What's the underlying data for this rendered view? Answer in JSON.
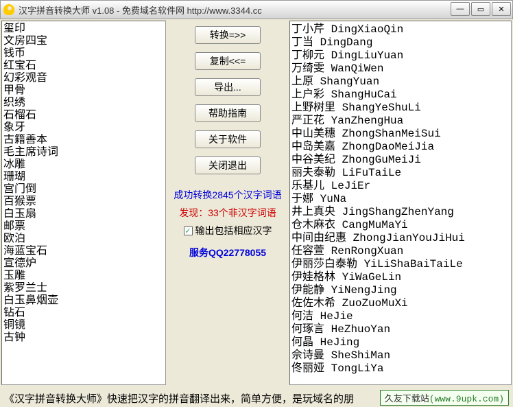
{
  "title": "汉字拼音转换大师 v1.08 - 免费域名软件网 http://www.3344.cc",
  "buttons": {
    "convert": "转换=>>",
    "copy": "复制<<=",
    "export": "导出...",
    "help": "帮助指南",
    "about": "关于软件",
    "close": "关闭退出"
  },
  "status": {
    "success": "成功转换2845个汉字词语",
    "warn": "发现：33个非汉字词语"
  },
  "checkbox": {
    "checked": true,
    "label": "输出包括相应汉字"
  },
  "qq": "服务QQ22778055",
  "footer": "《汉字拼音转换大师》快速把汉字的拼音翻译出来，简单方便，是玩域名的朋",
  "badge_cn": "久友下载站",
  "badge_en": "(www.9upk.com)",
  "left_items": [
    "玺印",
    "文房四宝",
    "钱币",
    "红宝石",
    "幻彩观音",
    "甲骨",
    "织绣",
    "石榴石",
    "象牙",
    "古籍善本",
    "毛主席诗词",
    "冰雕",
    "珊瑚",
    "宫门倒",
    "百猴票",
    "白玉扇",
    "邮票",
    "欧泊",
    "海蓝宝石",
    "宣德炉",
    "玉雕",
    "紫罗兰士",
    "白玉鼻烟壶",
    "钻石",
    "铜镜",
    "古钟"
  ],
  "right_items": [
    {
      "hz": "丁小芹",
      "py": "DingXiaoQin"
    },
    {
      "hz": "丁当",
      "py": "DingDang"
    },
    {
      "hz": "丁柳元",
      "py": "DingLiuYuan"
    },
    {
      "hz": "万绮雯",
      "py": "WanQiWen"
    },
    {
      "hz": "上原",
      "py": "ShangYuan"
    },
    {
      "hz": "上户彩",
      "py": "ShangHuCai"
    },
    {
      "hz": "上野树里",
      "py": "ShangYeShuLi"
    },
    {
      "hz": "严正花",
      "py": "YanZhengHua"
    },
    {
      "hz": "中山美穗",
      "py": "ZhongShanMeiSui"
    },
    {
      "hz": "中岛美嘉",
      "py": "ZhongDaoMeiJia"
    },
    {
      "hz": "中谷美纪",
      "py": "ZhongGuMeiJi"
    },
    {
      "hz": "丽夫泰勒",
      "py": "LiFuTaiLe"
    },
    {
      "hz": "乐基儿",
      "py": "LeJiEr"
    },
    {
      "hz": "于娜",
      "py": "YuNa"
    },
    {
      "hz": "井上真央",
      "py": "JingShangZhenYang"
    },
    {
      "hz": "仓木麻衣",
      "py": "CangMuMaYi"
    },
    {
      "hz": "中间由纪惠",
      "py": "ZhongJianYouJiHui"
    },
    {
      "hz": "任容萱",
      "py": "RenRongXuan"
    },
    {
      "hz": "伊丽莎白泰勒",
      "py": "YiLiShaBaiTaiLe"
    },
    {
      "hz": "伊娃格林",
      "py": "YiWaGeLin"
    },
    {
      "hz": "伊能静",
      "py": "YiNengJing"
    },
    {
      "hz": "佐佐木希",
      "py": "ZuoZuoMuXi"
    },
    {
      "hz": "何洁",
      "py": "HeJie"
    },
    {
      "hz": "何琢言",
      "py": "HeZhuoYan"
    },
    {
      "hz": "何晶",
      "py": "HeJing"
    },
    {
      "hz": "佘诗曼",
      "py": "SheShiMan"
    },
    {
      "hz": "佟丽娅",
      "py": "TongLiYa"
    }
  ]
}
